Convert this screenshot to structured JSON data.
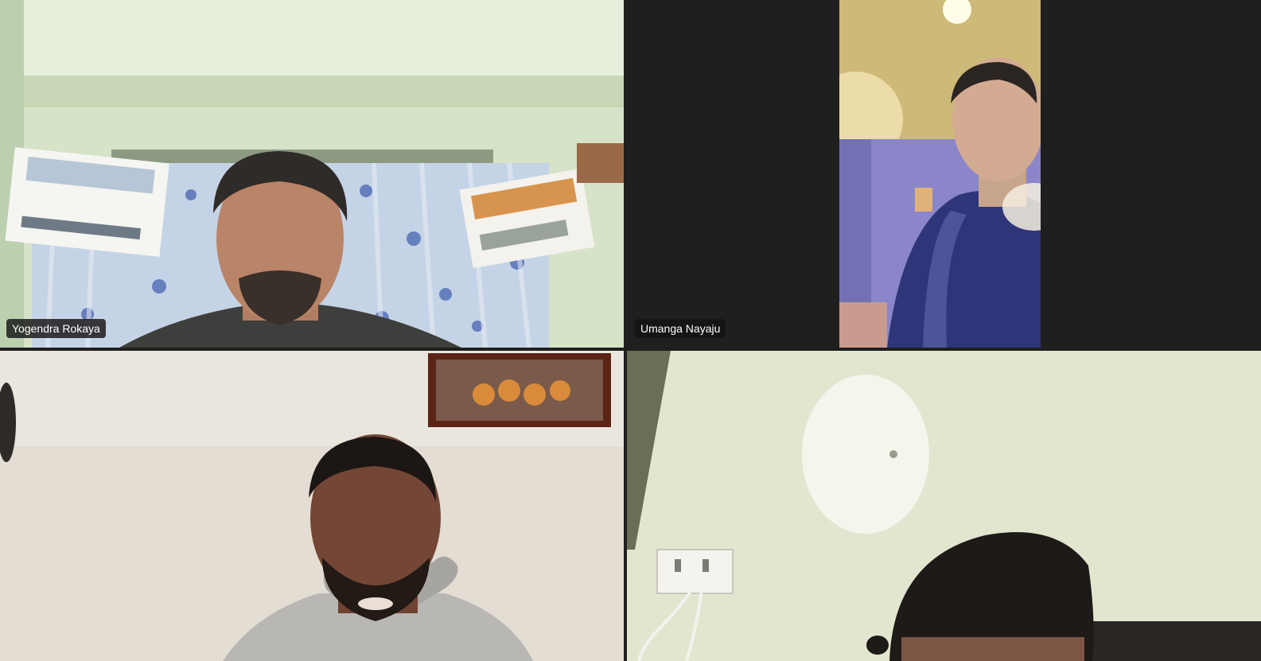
{
  "meeting": {
    "participants": [
      {
        "name": "Yogendra Rokaya",
        "show_label": true,
        "active_speaker": false
      },
      {
        "name": "Umanga Nayaju",
        "show_label": true,
        "active_speaker": false
      },
      {
        "name": "",
        "show_label": false,
        "active_speaker": true
      },
      {
        "name": "",
        "show_label": false,
        "active_speaker": false
      }
    ]
  },
  "colors": {
    "background": "#1f1f1f",
    "active_speaker_border": "#7b7fe8",
    "name_tag_bg": "#141414",
    "name_tag_text": "#ffffff"
  }
}
